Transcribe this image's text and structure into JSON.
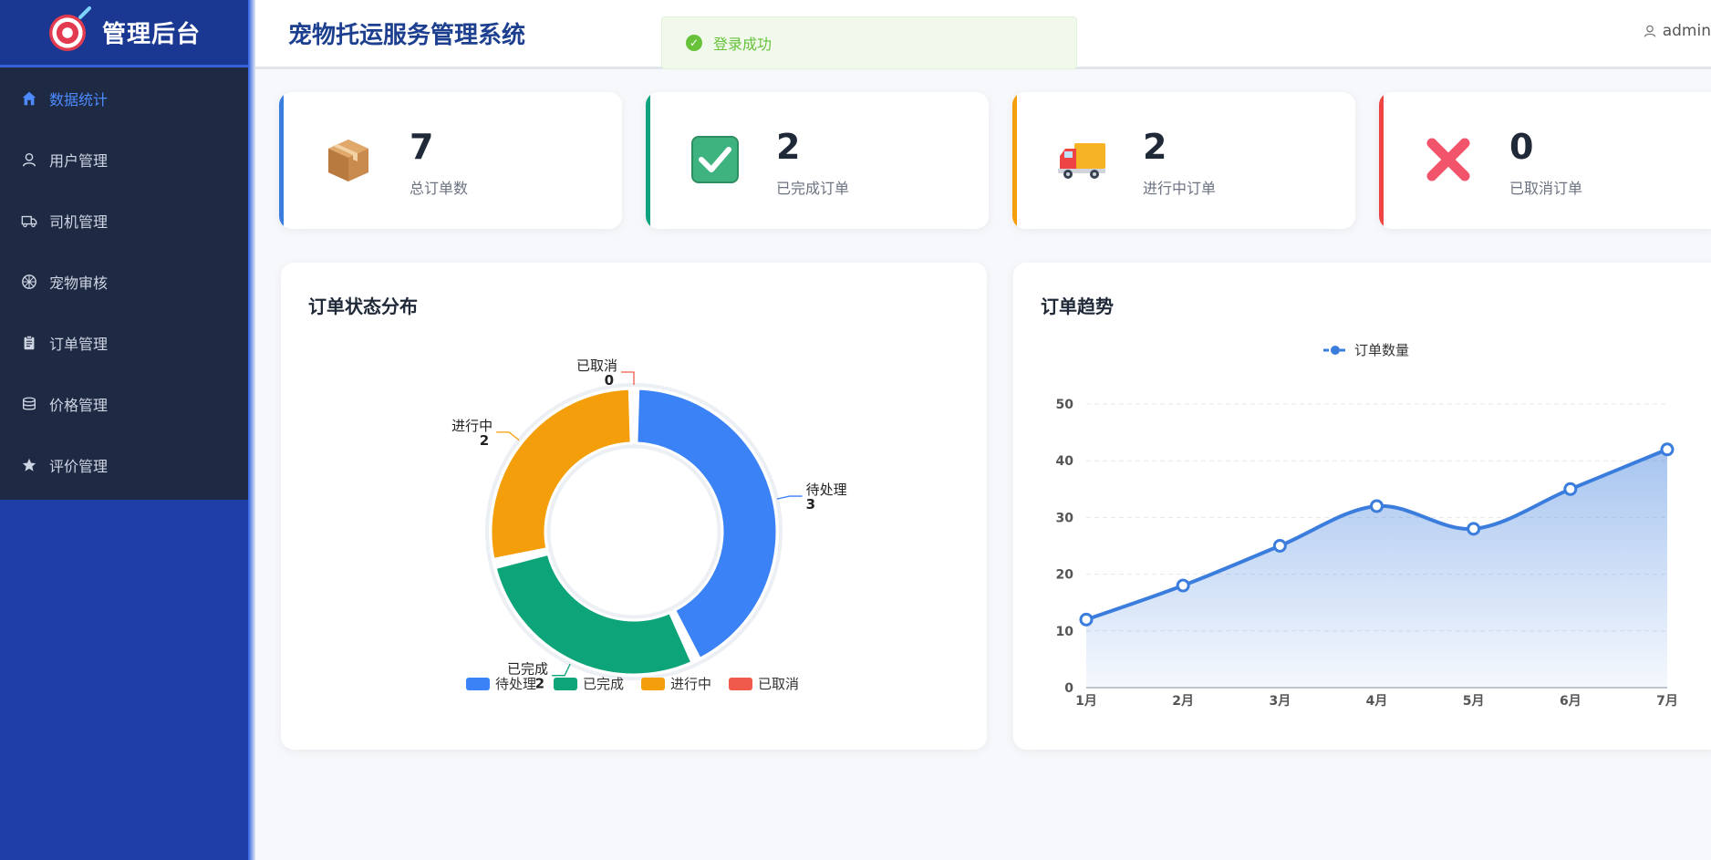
{
  "sidebar": {
    "brand_title": "管理后台",
    "items": [
      {
        "label": "数据统计",
        "icon": "home-icon",
        "active": true
      },
      {
        "label": "用户管理",
        "icon": "user-icon"
      },
      {
        "label": "司机管理",
        "icon": "truck-icon"
      },
      {
        "label": "宠物审核",
        "icon": "paw-icon"
      },
      {
        "label": "订单管理",
        "icon": "clipboard-icon"
      },
      {
        "label": "价格管理",
        "icon": "database-icon"
      },
      {
        "label": "评价管理",
        "icon": "star-icon"
      }
    ]
  },
  "header": {
    "title": "宠物托运服务管理系统",
    "toast": "登录成功",
    "user": "admin"
  },
  "stats": [
    {
      "value": "7",
      "label": "总订单数",
      "icon": "package-icon",
      "color": "#3b7ddd"
    },
    {
      "value": "2",
      "label": "已完成订单",
      "icon": "check-icon",
      "color": "#10a37f"
    },
    {
      "value": "2",
      "label": "进行中订单",
      "icon": "delivery-truck-icon",
      "color": "#f59e0b"
    },
    {
      "value": "0",
      "label": "已取消订单",
      "icon": "cross-icon",
      "color": "#ef4444"
    }
  ],
  "panels": {
    "pie_title": "订单状态分布",
    "line_title": "订单趋势"
  },
  "chart_data": [
    {
      "type": "pie",
      "title": "订单状态分布",
      "donut": true,
      "categories": [
        "待处理",
        "已完成",
        "进行中",
        "已取消"
      ],
      "values": [
        3,
        2,
        2,
        0
      ],
      "colors": [
        "#3b82f6",
        "#0ea47a",
        "#f59e0b",
        "#ef5a4a"
      ],
      "legend": "bottom"
    },
    {
      "type": "area",
      "title": "订单趋势",
      "x": [
        "1月",
        "2月",
        "3月",
        "4月",
        "5月",
        "6月",
        "7月"
      ],
      "series": [
        {
          "name": "订单数量",
          "values": [
            12,
            18,
            25,
            32,
            28,
            35,
            42
          ]
        }
      ],
      "ylim": [
        0,
        50
      ],
      "yticks": [
        0,
        10,
        20,
        30,
        40,
        50
      ],
      "color": "#3b7ddd",
      "smooth": true,
      "grid": true,
      "legend": "top-center"
    }
  ]
}
